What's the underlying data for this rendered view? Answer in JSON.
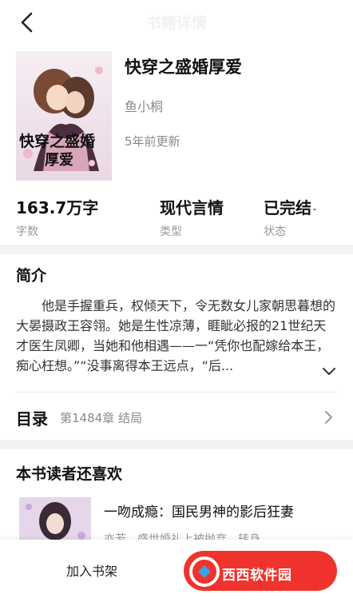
{
  "topbar": {
    "title": "书籍详情",
    "back_icon": "chevron-left-icon"
  },
  "book": {
    "title": "快穿之盛婚厚爱",
    "author": "鱼小桐",
    "updated": "5年前更新",
    "cover_title_line1": "快穿之盛婚",
    "cover_title_line2": "厚爱"
  },
  "stats": [
    {
      "value": "163.7万字",
      "label": "字数"
    },
    {
      "value": "现代言情",
      "label": "类型"
    },
    {
      "value": "已完结",
      "label": "状态"
    }
  ],
  "intro": {
    "heading": "简介",
    "text": "他是手握重兵，权倾天下，令无数女儿家朝思暮想的大晏摄政王容翎。她是生性凉薄，睚眦必报的21世纪天才医生凤卿，当她和他相遇——一“凭你也配嫁给本王，痴心枉想。”“没事离得本王远点，“后..."
  },
  "toc": {
    "heading": "目录",
    "latest": "第1484章 结局"
  },
  "recommend": {
    "heading": "本书读者还喜欢",
    "items": [
      {
        "title": "一吻成瘾：国民男神的影后狂妻",
        "desc": "亦若，盛世婚礼上被抛弃，转身"
      }
    ]
  },
  "bottom": {
    "add_shelf": "加入书架",
    "watermark": "西西软件园"
  },
  "colors": {
    "accent": "#f0332d",
    "band": "#f3f3f4",
    "muted": "#8a8a8a"
  }
}
